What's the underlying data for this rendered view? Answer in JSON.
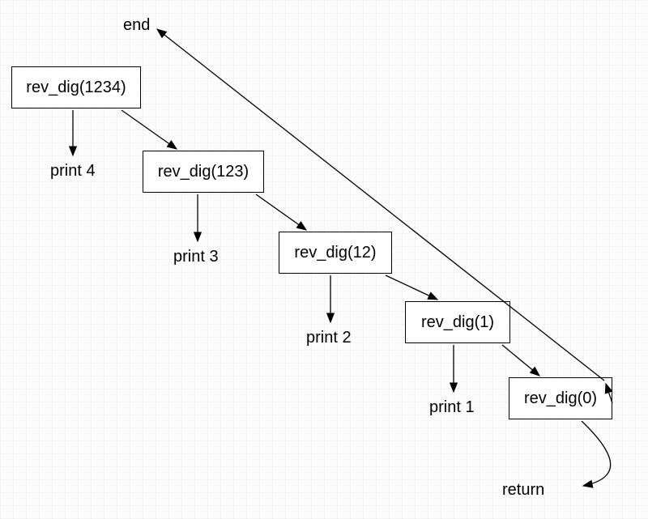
{
  "labels": {
    "end": "end",
    "return": "return"
  },
  "nodes": {
    "n1": {
      "text": "rev_dig(1234)",
      "print": "print 4"
    },
    "n2": {
      "text": "rev_dig(123)",
      "print": "print 3"
    },
    "n3": {
      "text": "rev_dig(12)",
      "print": "print 2"
    },
    "n4": {
      "text": "rev_dig(1)",
      "print": "print 1"
    },
    "n5": {
      "text": "rev_dig(0)"
    }
  }
}
